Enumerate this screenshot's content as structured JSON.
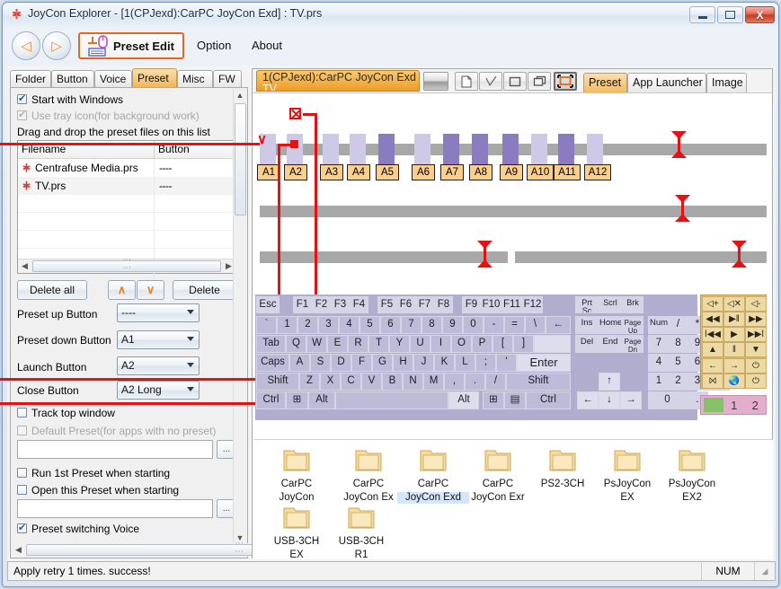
{
  "window": {
    "title": "JoyCon Explorer - [1(CPJexd):CarPC JoyCon Exd] : TV.prs",
    "app_icon": "joycon-cross-icon",
    "minimize_label": "Minimize",
    "maximize_label": "Maximize",
    "close_label": "X"
  },
  "toolbar": {
    "back_label": "◁",
    "forward_label": "▷",
    "preset_edit_label": "Preset Edit",
    "preset_edit_icon": "mouse-keyboard-icon",
    "menu": [
      {
        "label": "Option"
      },
      {
        "label": "About"
      }
    ]
  },
  "left_panel": {
    "tabs": [
      {
        "label": "Folder",
        "selected": false
      },
      {
        "label": "Button",
        "selected": false
      },
      {
        "label": "Voice",
        "selected": false
      },
      {
        "label": "Preset",
        "selected": true
      },
      {
        "label": "Misc",
        "selected": false
      },
      {
        "label": "FW",
        "selected": false
      }
    ],
    "checkboxes_top": [
      {
        "label": "Start with Windows",
        "checked": true,
        "disabled": false
      },
      {
        "label": "Use tray icon(for background work)",
        "checked": true,
        "disabled": true
      }
    ],
    "hint": "Drag and drop the preset files on this list",
    "file_list": {
      "columns": [
        "Filename",
        "Button"
      ],
      "rows": [
        {
          "icon": "joycon-cross-icon",
          "filename": "Centrafuse Media.prs",
          "button": "----"
        },
        {
          "icon": "joycon-cross-icon",
          "filename": "TV.prs",
          "button": "----"
        }
      ]
    },
    "buttons": {
      "delete_all": "Delete all",
      "move_up": "∧",
      "move_down": "∨",
      "delete": "Delete"
    },
    "assignments": [
      {
        "label": "Preset up Button",
        "value": "----"
      },
      {
        "label": "Preset down Button",
        "value": "A1"
      },
      {
        "label": "Launch Button",
        "value": "A2"
      },
      {
        "label": "Close Button",
        "value": "A2 Long"
      }
    ],
    "checkboxes_mid": [
      {
        "label": "Track top window",
        "checked": false,
        "disabled": false
      },
      {
        "label": "Default Preset(for apps with no preset)",
        "checked": false,
        "disabled": true
      }
    ],
    "path_field_1": "",
    "checkboxes_low": [
      {
        "label": "Run  1st Preset when starting",
        "checked": false,
        "disabled": false
      },
      {
        "label": "Open this Preset when starting",
        "checked": false,
        "disabled": false
      }
    ],
    "path_field_2": "",
    "checkboxes_bottom": [
      {
        "label": "Preset switching Voice",
        "checked": true,
        "disabled": false
      }
    ],
    "browse_label": "...",
    "scroll_up": "▲",
    "scroll_down": "▼",
    "scroll_left": "◀",
    "scroll_right": "▶"
  },
  "right_panel": {
    "preset_tab_line1": "1(CPJexd):CarPC JoyCon Exd",
    "preset_tab_line2": "TV",
    "tools": [
      {
        "name": "gradient-swatch",
        "label": ""
      },
      {
        "name": "new-document-icon",
        "label": ""
      },
      {
        "name": "checkmark-icon",
        "label": ""
      },
      {
        "name": "window-icon",
        "label": ""
      },
      {
        "name": "windows-cascade-icon",
        "label": ""
      },
      {
        "name": "fullscreen-icon",
        "label": ""
      }
    ],
    "tabs": [
      {
        "label": "Preset",
        "selected": true
      },
      {
        "label": "App Launcher",
        "selected": false
      },
      {
        "label": "Image",
        "selected": false
      }
    ],
    "a_buttons": [
      {
        "label": "A1",
        "block": "off"
      },
      {
        "label": "A2",
        "block": "off"
      },
      {
        "label": "A3",
        "block": "off"
      },
      {
        "label": "A4",
        "block": "off"
      },
      {
        "label": "A5",
        "block": "on"
      },
      {
        "label": "A6",
        "block": "off"
      },
      {
        "label": "A7",
        "block": "on"
      },
      {
        "label": "A8",
        "block": "on"
      },
      {
        "label": "A9",
        "block": "on"
      },
      {
        "label": "A10",
        "block": "off"
      },
      {
        "label": "A11",
        "block": "on"
      },
      {
        "label": "A12",
        "block": "off"
      }
    ]
  },
  "keyboard": {
    "row_fn": [
      "Esc",
      "F1",
      "F2",
      "F3",
      "F4",
      "F5",
      "F6",
      "F7",
      "F8",
      "F9",
      "F10",
      "F11",
      "F12"
    ],
    "row_num": [
      "`",
      "1",
      "2",
      "3",
      "4",
      "5",
      "6",
      "7",
      "8",
      "9",
      "0",
      "-",
      "=",
      "\\",
      "←"
    ],
    "row_q": [
      "Tab",
      "Q",
      "W",
      "E",
      "R",
      "T",
      "Y",
      "U",
      "I",
      "O",
      "P",
      "[",
      "]"
    ],
    "row_a": [
      "Caps",
      "A",
      "S",
      "D",
      "F",
      "G",
      "H",
      "J",
      "K",
      "L",
      ";",
      "'",
      "Enter"
    ],
    "row_z": [
      "Shift",
      "Z",
      "X",
      "C",
      "V",
      "B",
      "N",
      "M",
      ",",
      ".",
      "/",
      "Shift"
    ],
    "row_ctrl": [
      "Ctrl",
      "⊞",
      "Alt",
      "",
      "Alt",
      "⊞",
      "▤",
      "Ctrl"
    ],
    "cluster_top": [
      "Prt Sc",
      "Scrl",
      "Brk"
    ],
    "cluster_mid": [
      "Ins",
      "Home",
      "Page Up"
    ],
    "cluster_low": [
      "Del",
      "End",
      "Page Dn"
    ],
    "arrows": [
      "↑",
      "←",
      "↓",
      "→"
    ],
    "numpad": [
      "Num",
      "/",
      "*",
      "-",
      "7",
      "8",
      "9",
      "+",
      "4",
      "5",
      "6",
      "1",
      "2",
      "3",
      "↵",
      "0",
      "."
    ],
    "media": [
      "◁+",
      "◁✕",
      "◁-",
      "◀◀",
      "▶ǁ",
      "▶▶",
      "ǀ◀◀",
      "▶",
      "▶▶ǀ",
      "▲",
      "ǁ",
      "▼",
      "←",
      "→",
      "⏻",
      "⨝",
      "🌏",
      "⏻"
    ],
    "channel": [
      "1",
      "2"
    ]
  },
  "folders": {
    "items": [
      {
        "icon": "folder-icon",
        "label_line1": "CarPC",
        "label_line2": "JoyCon",
        "selected": false
      },
      {
        "icon": "folder-icon",
        "label_line1": "CarPC",
        "label_line2": "JoyCon Ex",
        "selected": false
      },
      {
        "icon": "folder-icon",
        "label_line1": "CarPC",
        "label_line2": "JoyCon Exd",
        "selected": true
      },
      {
        "icon": "folder-icon",
        "label_line1": "CarPC",
        "label_line2": "JoyCon Exr",
        "selected": false
      },
      {
        "icon": "folder-icon",
        "label_line1": "PS2-3CH",
        "label_line2": "",
        "selected": false
      },
      {
        "icon": "folder-icon",
        "label_line1": "PsJoyCon",
        "label_line2": "EX",
        "selected": false
      },
      {
        "icon": "folder-icon",
        "label_line1": "PsJoyCon",
        "label_line2": "EX2",
        "selected": false
      },
      {
        "icon": "folder-icon",
        "label_line1": "USB-3CH",
        "label_line2": "EX",
        "selected": false
      },
      {
        "icon": "folder-icon",
        "label_line1": "USB-3CH",
        "label_line2": "R1",
        "selected": false
      }
    ]
  },
  "status": {
    "message": "Apply retry  1 times. success!",
    "num_indicator": "NUM"
  },
  "colors": {
    "accent_orange": "#e8661a",
    "tab_orange": "#ec9d28",
    "wire_red": "#e81010",
    "key_purple": "#8b7bc0",
    "abutton_tan": "#fbcf8a"
  }
}
